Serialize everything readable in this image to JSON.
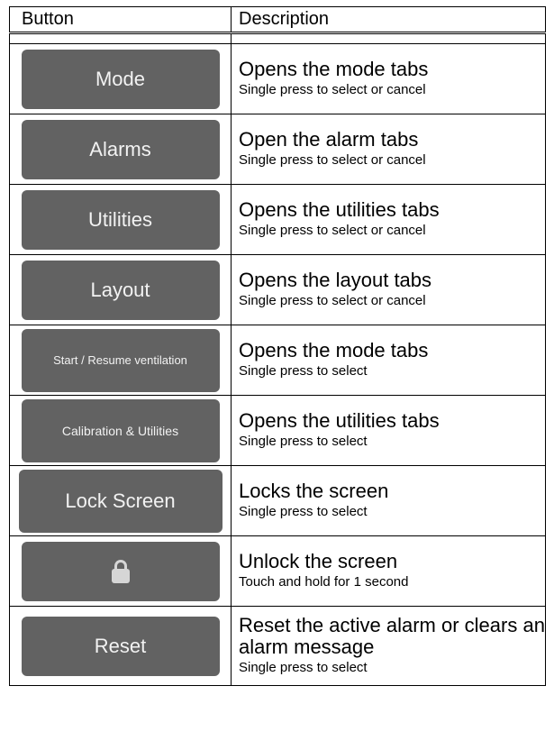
{
  "headers": {
    "button": "Button",
    "description": "Description"
  },
  "rows": [
    {
      "button_label": "Mode",
      "title": "Opens the mode tabs",
      "sub": "Single press to select or cancel"
    },
    {
      "button_label": "Alarms",
      "title": "Open the alarm tabs",
      "sub": "Single press to select or cancel"
    },
    {
      "button_label": "Utilities",
      "title": "Opens the utilities tabs",
      "sub": "Single press to select or cancel"
    },
    {
      "button_label": "Layout",
      "title": "Opens the layout tabs",
      "sub": "Single press to select or cancel"
    },
    {
      "button_label": "Start / Resume ventilation",
      "title": "Opens the mode tabs",
      "sub": "Single press to select"
    },
    {
      "button_label": "Calibration & Utilities",
      "title": "Opens the utilities tabs",
      "sub": "Single press to select"
    },
    {
      "button_label": "Lock Screen",
      "title": "Locks the screen",
      "sub": "Single press to select"
    },
    {
      "button_icon": "lock-icon",
      "title": "Unlock the screen",
      "sub": "Touch and hold for 1 second"
    },
    {
      "button_label": "Reset",
      "title": "Reset the active alarm or clears an alarm message",
      "sub": "Single press to select"
    }
  ],
  "colors": {
    "button_bg": "#626262",
    "button_text": "#f2f2f2",
    "border": "#000000"
  }
}
